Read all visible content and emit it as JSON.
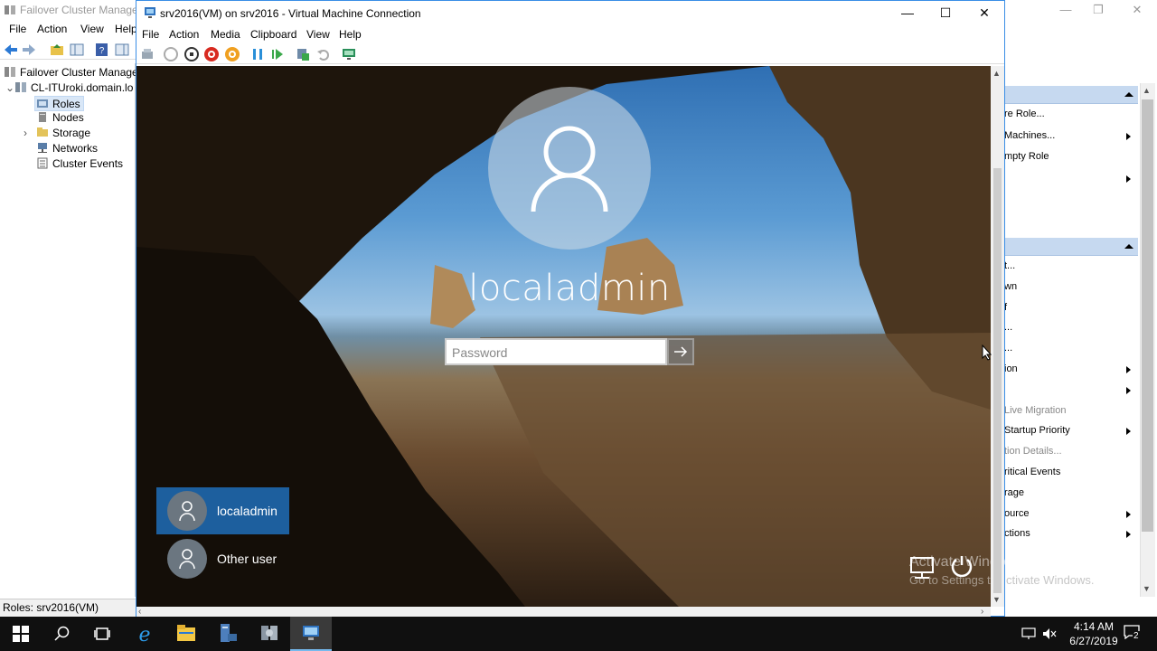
{
  "fcm": {
    "title": "Failover Cluster Manager",
    "menu": [
      "File",
      "Action",
      "View",
      "Help"
    ],
    "tree": {
      "root": "Failover Cluster Manager",
      "cluster": "CL-ITUroki.domain.lo",
      "items": [
        "Roles",
        "Nodes",
        "Storage",
        "Networks",
        "Cluster Events"
      ]
    },
    "status": "Roles:  srv2016(VM)",
    "actions": {
      "section1": [
        {
          "label": "re Role...",
          "disabled": false,
          "submenu": false
        },
        {
          "label": "Machines...",
          "disabled": false,
          "submenu": true
        },
        {
          "label": "mpty Role",
          "disabled": false,
          "submenu": false
        },
        {
          "label": "",
          "disabled": false,
          "submenu": true
        }
      ],
      "section2": [
        {
          "label": "t...",
          "disabled": false,
          "submenu": false
        },
        {
          "label": "wn",
          "disabled": false,
          "submenu": false
        },
        {
          "label": "f",
          "disabled": false,
          "submenu": false
        },
        {
          "label": "...",
          "disabled": false,
          "submenu": false
        },
        {
          "label": "...",
          "disabled": false,
          "submenu": false
        },
        {
          "label": "ion",
          "disabled": false,
          "submenu": true
        },
        {
          "label": "",
          "disabled": false,
          "submenu": true
        },
        {
          "label": "Live Migration",
          "disabled": true,
          "submenu": false
        },
        {
          "label": "Startup Priority",
          "disabled": false,
          "submenu": true
        },
        {
          "label": "tion Details...",
          "disabled": true,
          "submenu": false
        },
        {
          "label": "ritical Events",
          "disabled": false,
          "submenu": false
        },
        {
          "label": "rage",
          "disabled": false,
          "submenu": false
        },
        {
          "label": "ource",
          "disabled": false,
          "submenu": true
        },
        {
          "label": "ctions",
          "disabled": false,
          "submenu": true
        }
      ]
    }
  },
  "vmc": {
    "title": "srv2016(VM) on srv2016 - Virtual Machine Connection",
    "menu": [
      "File",
      "Action",
      "Media",
      "Clipboard",
      "View",
      "Help"
    ],
    "controls": {
      "minimize": "—",
      "maximize": "☐",
      "close": "✕"
    }
  },
  "login": {
    "username": "localadmin",
    "password_placeholder": "Password",
    "password_value": "",
    "users": [
      "localadmin",
      "Other user"
    ]
  },
  "watermark": {
    "line1": "Activate Windows",
    "line2": "Go to Settings to",
    "line3": "ctivate Windows."
  },
  "taskbar": {
    "time": "4:14 AM",
    "date": "6/27/2019",
    "notification_count": "2"
  },
  "colors": {
    "accent": "#1d5f9e",
    "window_border": "#3a8ee6",
    "taskbar": "#101010",
    "actions_header": "#c6d9f0"
  }
}
